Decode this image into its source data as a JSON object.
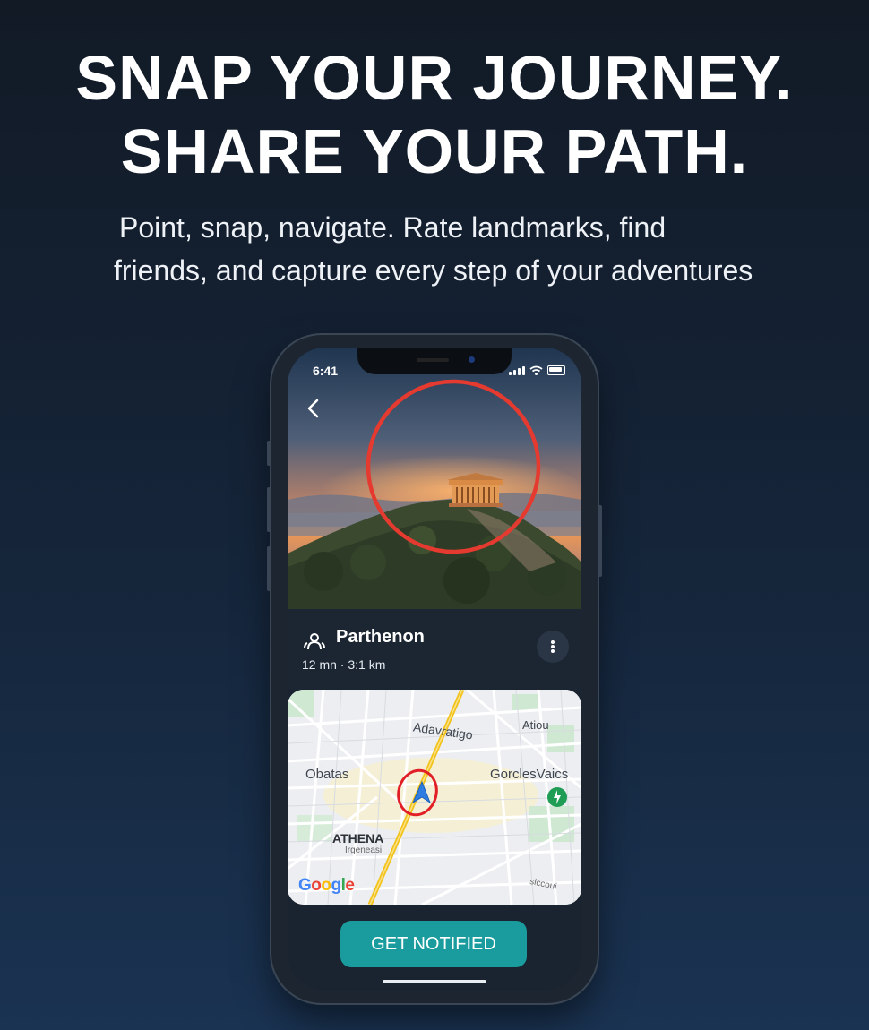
{
  "headline": {
    "line1": "SNAP YOUR JOURNEY.",
    "line2": "SHARE YOUR PATH."
  },
  "subtitle": {
    "line1": "Point, snap, navigate. Rate landmarks, find",
    "line2": "friends, and capture every step of your adventures"
  },
  "phone": {
    "status_time": "6:41",
    "landmark": {
      "name": "Parthenon",
      "meta": "12 mn · 3:1 km"
    },
    "map": {
      "labels": {
        "top_right": "Atiou",
        "street": "Adavratigo",
        "left": "Obatas",
        "right": "GorclesVaics",
        "city": "ATHENA",
        "city_sub": "Irgeneasi",
        "corner": "siccoui",
        "attribution": "Google"
      }
    },
    "cta_label": "GET NOTIFIED"
  },
  "colors": {
    "accent_teal": "#1a9c9e",
    "highlight_red": "#e53a2f",
    "map_route_yellow": "#f2c31b",
    "location_marker_blue": "#2f7de1"
  },
  "icons": [
    "back-chevron-icon",
    "signal-icon",
    "wifi-icon",
    "battery-icon",
    "landmark-people-icon",
    "more-dots-icon",
    "location-arrow-icon",
    "map-pin-icon"
  ]
}
